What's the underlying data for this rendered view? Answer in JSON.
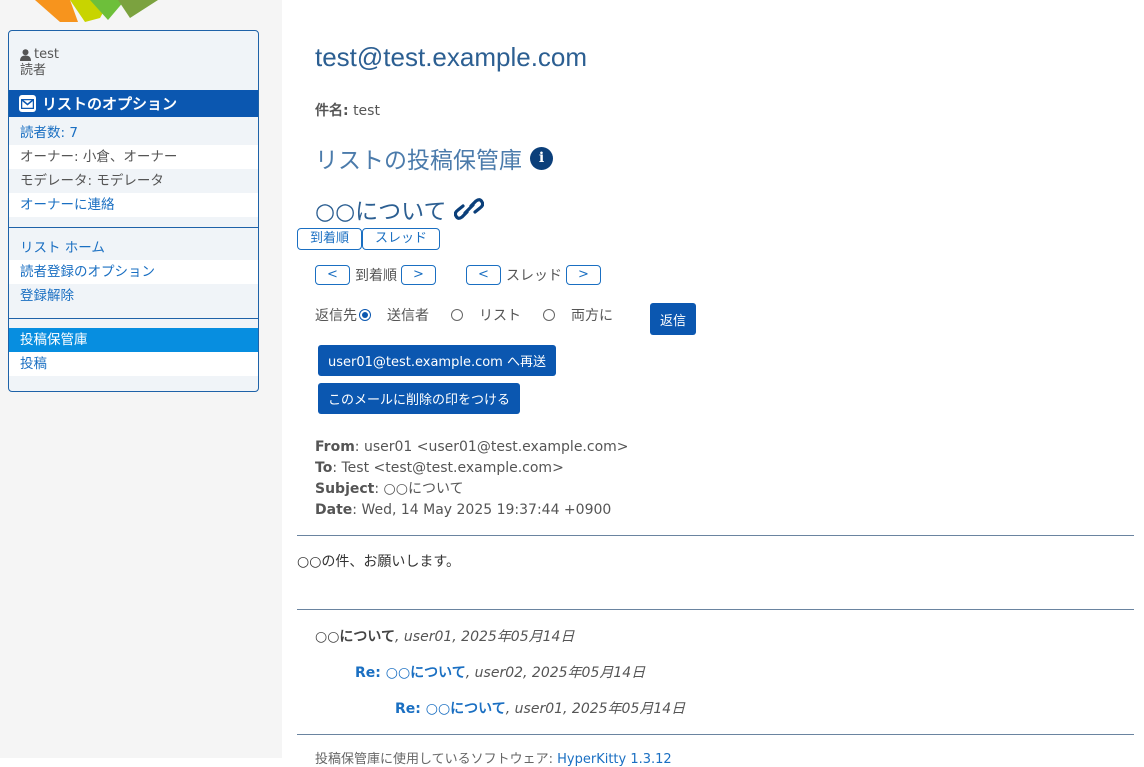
{
  "sidebar": {
    "user": {
      "name": "test",
      "role": "読者"
    },
    "header_title": "リストのオプション",
    "info_items": [
      {
        "label": "読者数: 7"
      },
      {
        "label": "オーナー: 小倉、オーナー"
      },
      {
        "label": "モデレータ: モデレータ"
      },
      {
        "label": "オーナーに連絡"
      }
    ],
    "nav_items": [
      {
        "label": "リスト ホーム"
      },
      {
        "label": "読者登録のオプション"
      },
      {
        "label": "登録解除"
      }
    ],
    "archive_items": [
      {
        "label": "投稿保管庫",
        "active": true
      },
      {
        "label": "投稿"
      }
    ]
  },
  "main": {
    "list_address": "test@test.example.com",
    "subject_label": "件名:",
    "subject_value": "test",
    "archive_title": "リストの投稿保管庫",
    "message_title": "○○について",
    "tabs": [
      "到着順",
      "スレッド"
    ],
    "nav": {
      "prev": "<",
      "next": ">",
      "by_date": "到着順",
      "by_thread": "スレッド"
    },
    "reply": {
      "label": "返信先",
      "options": [
        "送信者",
        "リスト",
        "両方に"
      ],
      "selected": "送信者",
      "button": "返信"
    },
    "resend_button": "user01@test.example.com へ再送",
    "delete_button": "このメールに削除の印をつける",
    "headers": {
      "from_label": "From",
      "from": "user01 <user01@test.example.com>",
      "to_label": "To",
      "to": "Test <test@test.example.com>",
      "subject_label": "Subject",
      "subject": "○○について",
      "date_label": "Date",
      "date": "Wed, 14 May 2025 19:37:44 +0900"
    },
    "body": "○○の件、お願いします。",
    "thread": [
      {
        "title": "○○について",
        "meta": "user01, 2025年05月14日"
      },
      {
        "title": "Re: ○○について",
        "meta": "user02, 2025年05月14日"
      },
      {
        "title": "Re: ○○について",
        "meta": "user01, 2025年05月14日"
      }
    ],
    "footer": {
      "text": "投稿保管庫に使用しているソフトウェア: ",
      "link": "HyperKitty 1.3.12"
    }
  },
  "colors": {
    "accent": "#0b57b0",
    "link": "#1a6fc2",
    "active": "#078ee0"
  }
}
